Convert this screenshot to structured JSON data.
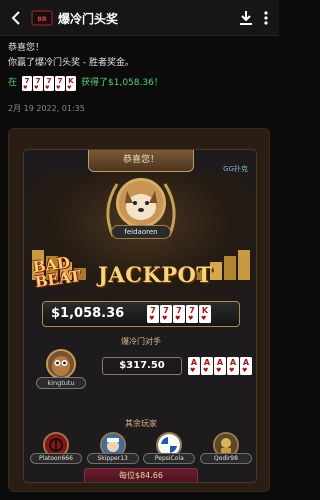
{
  "header": {
    "title": "爆冷门头奖",
    "icons": [
      "back-arrow-icon",
      "jackpot-logo-icon",
      "download-icon",
      "more-vertical-icon"
    ]
  },
  "message": {
    "line1": "恭喜您！",
    "line2": "你赢了爆冷门头奖 - 胜者奖金。",
    "prefix": "在",
    "cards": [
      "7",
      "7",
      "7",
      "7",
      "K"
    ],
    "suffix": "获得了$1,058.36！",
    "timestamp": "2月 19 2022, 01:35"
  },
  "card": {
    "banner": "恭喜您！",
    "tag": "GG扑克",
    "winner_name": "feidaoren",
    "bad_beat_word1": "BAD",
    "bad_beat_word2": "BEAT",
    "jackpot_word": "JACKPOT",
    "amount": "$1,058.36",
    "hand_cards": [
      "7",
      "7",
      "7",
      "7",
      "K"
    ],
    "opponent_title": "爆冷门对手",
    "opponent": {
      "name": "kingtutu",
      "prize": "$317.50",
      "cards": [
        "A",
        "A",
        "A",
        "A",
        "A"
      ]
    },
    "others_title": "其余玩家",
    "players": [
      {
        "name": "Platoon666"
      },
      {
        "name": "Skipper13"
      },
      {
        "name": "PepsiCola"
      },
      {
        "name": "Qodir98"
      }
    ],
    "each_prize": "每位$84.66"
  },
  "colors": {
    "background": "#0b0b0b",
    "accent_gold": "#f8d576",
    "green_text": "#5ad07a",
    "heart_red": "#b60d0d"
  }
}
